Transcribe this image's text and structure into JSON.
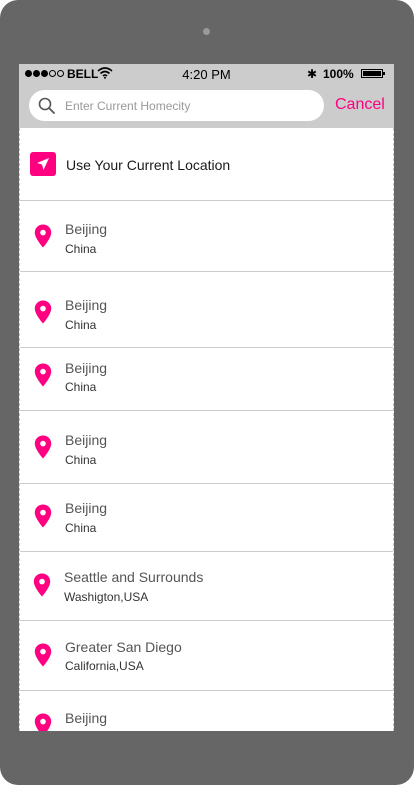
{
  "status": {
    "carrier": "BELL",
    "time": "4:20 PM",
    "battery": "100%",
    "bluetooth": "✱"
  },
  "search": {
    "placeholder": "Enter Current Homecity",
    "cancel_label": "Cancel"
  },
  "current_location": {
    "label": "Use Your Current Location",
    "icon": "navigation-arrow-icon"
  },
  "locations": [
    {
      "city": "Beijing",
      "region": "China"
    },
    {
      "city": "Beijing",
      "region": "China"
    },
    {
      "city": "Beijing",
      "region": "China"
    },
    {
      "city": "Beijing",
      "region": "China"
    },
    {
      "city": "Beijing",
      "region": "China"
    },
    {
      "city": "Seattle and Surrounds",
      "region": "Washigton,USA"
    },
    {
      "city": "Greater San Diego",
      "region": "California,USA"
    },
    {
      "city": "Beijing",
      "region": ""
    }
  ],
  "colors": {
    "accent": "#ff0080",
    "bar": "#cccccc",
    "device": "#666666"
  }
}
